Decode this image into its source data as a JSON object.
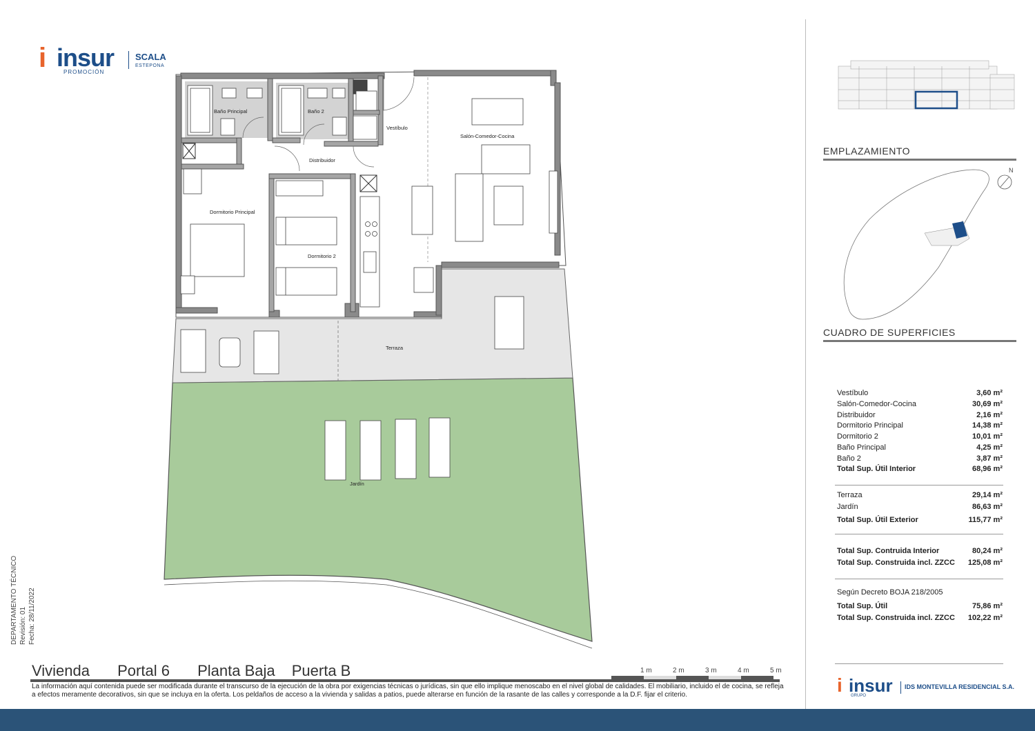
{
  "header": {
    "logo_word": "insur",
    "logo_sub": "PROMOCIÓN",
    "scala": "SCALA",
    "estepona": "ESTEPONA"
  },
  "rooms": {
    "bano_principal": "Baño Principal",
    "bano_2": "Baño 2",
    "vestibulo": "Vestíbulo",
    "salon": "Salón-Comedor-Cocina",
    "distribuidor": "Distribuidor",
    "dormitorio_principal": "Dormitorio Principal",
    "dormitorio_2": "Dormitorio 2",
    "terraza": "Terraza",
    "jardin": "Jardín"
  },
  "right_panel": {
    "emplazamiento": "EMPLAZAMIENTO",
    "north": "N",
    "cuadro": "CUADRO DE SUPERFICIES"
  },
  "areas_interior": [
    {
      "label": "Vestíbulo",
      "value": "3,60 m²"
    },
    {
      "label": "Salón-Comedor-Cocina",
      "value": "30,69 m²"
    },
    {
      "label": "Distribuidor",
      "value": "2,16 m²"
    },
    {
      "label": "Dormitorio Principal",
      "value": "14,38 m²"
    },
    {
      "label": "Dormitorio 2",
      "value": "10,01 m²"
    },
    {
      "label": "Baño Principal",
      "value": "4,25 m²"
    },
    {
      "label": "Baño 2",
      "value": "3,87 m²"
    },
    {
      "label": "Total Sup. Útil Interior",
      "value": "68,96 m²"
    }
  ],
  "areas_exterior": [
    {
      "label": "Terraza",
      "value": "29,14 m²"
    },
    {
      "label": "Jardín",
      "value": "86,63 m²"
    },
    {
      "label": "Total Sup. Útil Exterior",
      "value": "115,77 m²"
    }
  ],
  "areas_construida": [
    {
      "label": "Total Sup. Contruida Interior",
      "value": "80,24 m²"
    },
    {
      "label": "Total Sup. Construida incl. ZZCC",
      "value": "125,08 m²"
    }
  ],
  "decreto": {
    "title": "Según Decreto BOJA 218/2005",
    "rows": [
      {
        "label": "Total Sup. Útil",
        "value": "75,86 m²"
      },
      {
        "label": "Total Sup. Construida incl. ZZCC",
        "value": "102,22 m²"
      }
    ]
  },
  "unit_title": {
    "vivienda": "Vivienda",
    "portal": "Portal 6",
    "planta": "Planta Baja",
    "puerta": "Puerta B"
  },
  "scale_labels": [
    "1 m",
    "2 m",
    "3 m",
    "4 m",
    "5 m"
  ],
  "disclaimer": "La información aquí contenida puede ser modificada durante el transcurso de la ejecución de la obra por exigencias técnicas o jurídicas, sin que ello implique menoscabo en el nivel global de calidades. El mobiliario, incluido el de cocina, se refleja a efectos meramente decorativos, sin que se incluya en la oferta. Los peldaños de acceso a la vivienda y salidas a patios, puede alterarse en función de la rasante de las calles y corresponde a la D.F. fijar el criterio.",
  "side_info": {
    "dept": "DEPARTAMENTO TÉCNICO",
    "revision": "Revisión: 01",
    "fecha": "Fecha: 28/11/2022"
  },
  "bottom_logo": {
    "word": "insur",
    "grupo": "GRUPO",
    "ids": "IDS MONTEVILLA RESIDENCIAL S.A."
  },
  "colors": {
    "brand_blue": "#1d4e89",
    "brand_orange": "#e8642c",
    "garden_green": "#a8cb9b",
    "terrace_grey": "#e6e6e6",
    "footer_bar": "#2b5378"
  }
}
